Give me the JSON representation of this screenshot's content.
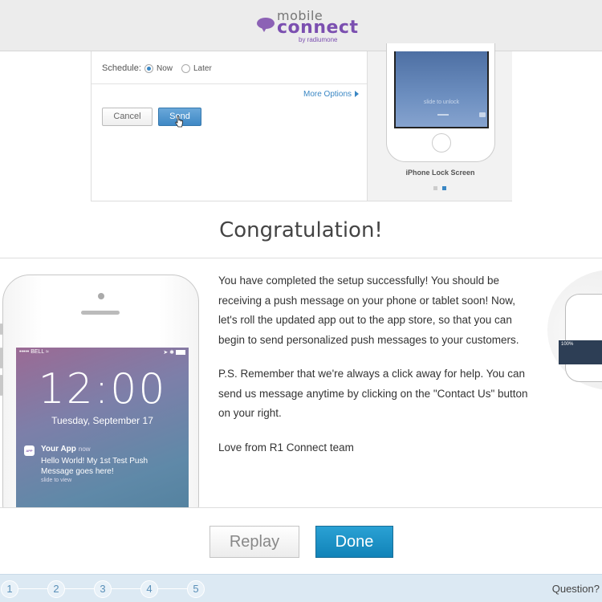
{
  "header": {
    "logo_top": "mobile",
    "logo_main": "connect",
    "logo_by": "by radiumone"
  },
  "preview": {
    "schedule_label": "Schedule:",
    "radio_now": "Now",
    "radio_later": "Later",
    "schedule_selected": "Now",
    "more_options": "More Options",
    "cancel_label": "Cancel",
    "send_label": "Send",
    "mini_slide": "slide to unlock",
    "lock_caption": "iPhone Lock Screen",
    "carousel_active_index": 2
  },
  "congrats": {
    "title": "Congratulation!",
    "paragraphs": [
      "You have completed the setup successfully! You should be receiving a push message on your phone or tablet soon! Now, let's roll the updated app out to the app store, so that you can begin to send personalized push messages to your customers.",
      "P.S. Remember that we're always a click away for help. You can send us message anytime by clicking on the \"Contact Us\" button on your right.",
      "Love from R1 Connect team"
    ]
  },
  "phone": {
    "carrier": "BELL",
    "time": "12:00",
    "date": "Tuesday, September 17",
    "app_icon": "APP",
    "notification_title": "Your App",
    "notification_time": "now",
    "notification_message": "Hello World! My 1st Test Push Message goes here!",
    "notification_slide": "slide to view",
    "peek_battery": "100%"
  },
  "actions": {
    "replay_label": "Replay",
    "done_label": "Done"
  },
  "footer": {
    "steps": [
      "1",
      "2",
      "3",
      "4",
      "5"
    ],
    "question_label": "Question?"
  },
  "colors": {
    "brand_purple": "#7b4fb0",
    "accent_blue": "#1183b8",
    "link_blue": "#3a87c4"
  }
}
